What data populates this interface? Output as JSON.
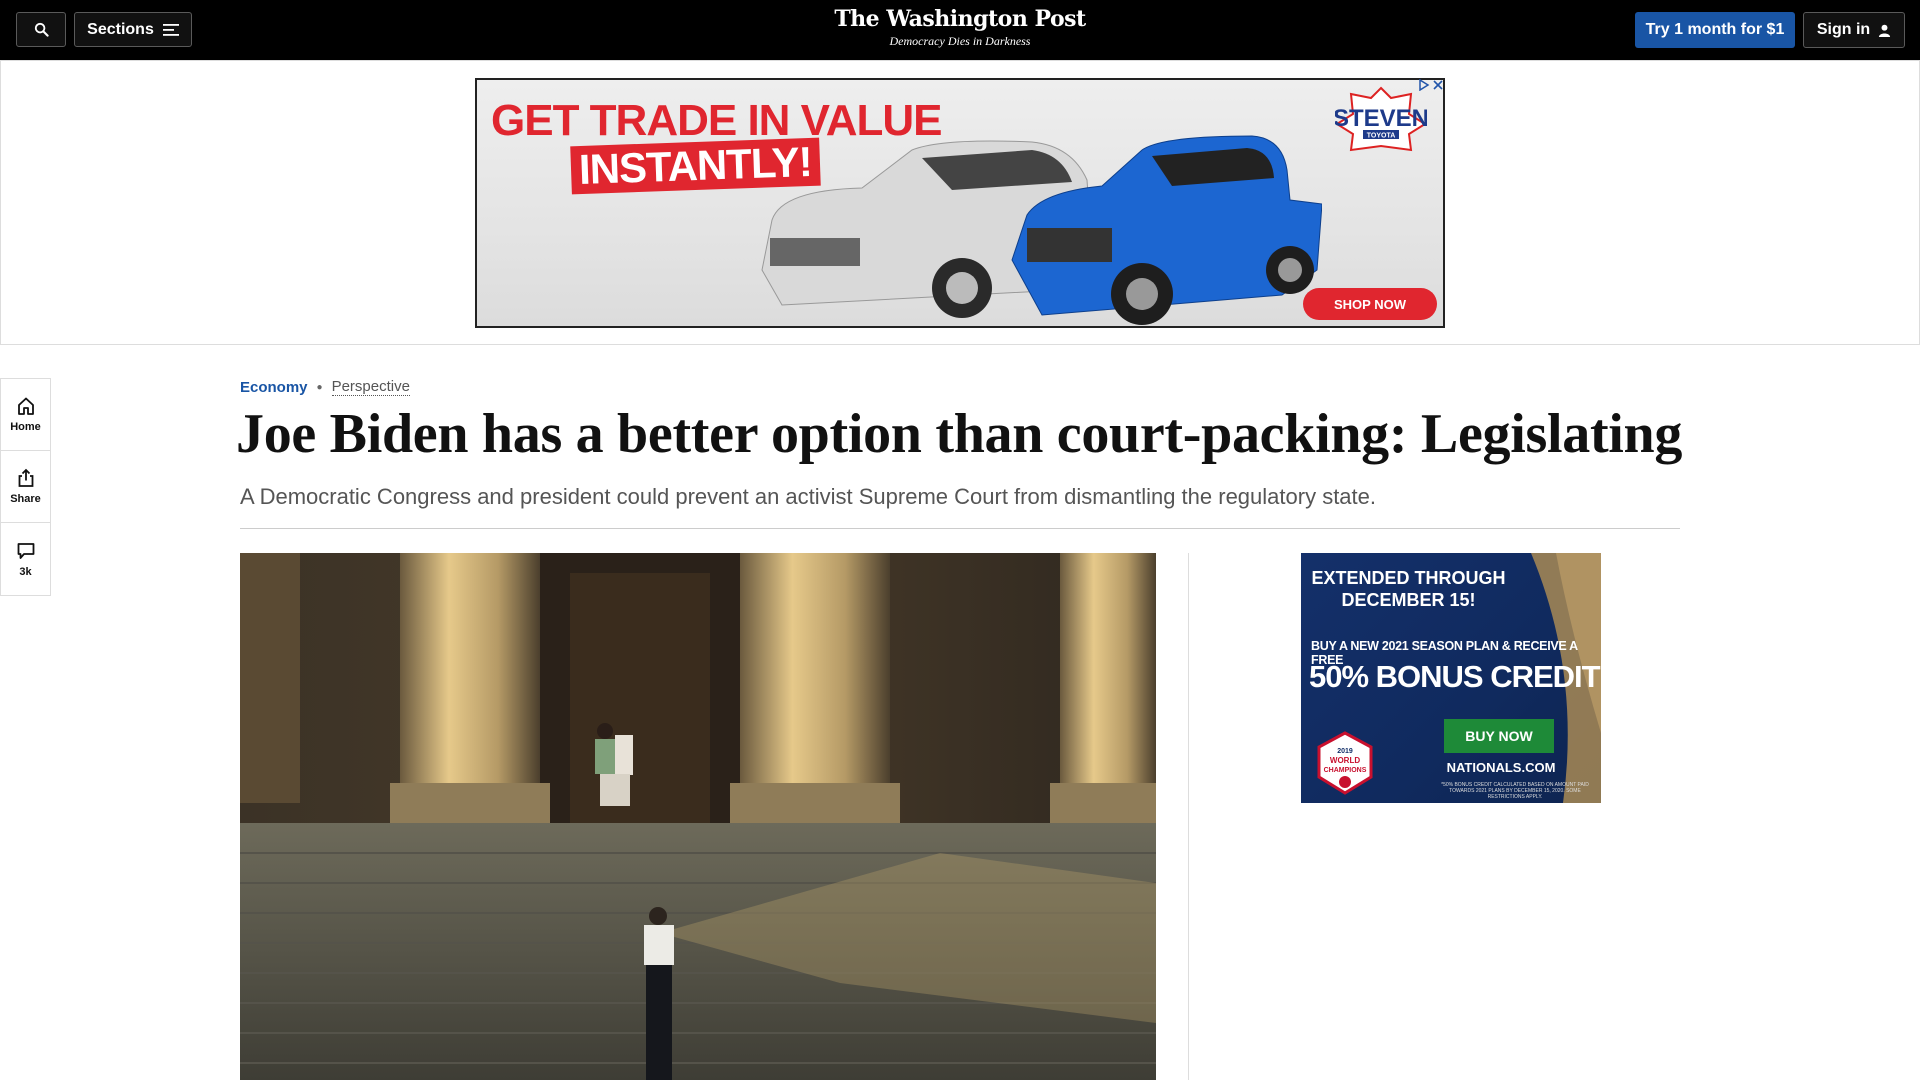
{
  "topbar": {
    "sections_label": "Sections",
    "logo": "The Washington Post",
    "tagline": "Democracy Dies in Darkness",
    "subscribe_label": "Try 1 month for $1",
    "signin_label": "Sign in"
  },
  "ad_banner": {
    "headline_line1": "GET TRADE IN VALUE",
    "headline_line2": "INSTANTLY!",
    "dealer_name": "STEVEN",
    "dealer_brand": "TOYOTA",
    "cta": "SHOP NOW"
  },
  "left_rail": {
    "items": [
      {
        "label": "Home",
        "icon": "home-icon"
      },
      {
        "label": "Share",
        "icon": "share-icon"
      },
      {
        "label": "3k",
        "icon": "comment-icon"
      }
    ]
  },
  "article": {
    "section": "Economy",
    "label": "Perspective",
    "headline": "Joe Biden has a better option than court-packing: Legislating",
    "dek": "A Democratic Congress and president could prevent an activist Supreme Court from dismantling the regulatory state."
  },
  "side_ad": {
    "line1": "EXTENDED THROUGH",
    "line2": "DECEMBER 15!",
    "offer_line": "BUY A NEW 2021 SEASON PLAN & RECEIVE A FREE",
    "offer_big": "50% BONUS CREDIT",
    "cta": "BUY NOW",
    "site": "NATIONALS.COM",
    "fine_print": "*50% BONUS CREDIT CALCULATED BASED ON AMOUNT PAID TOWARDS 2021 PLANS BY DECEMBER 15, 2020. SOME RESTRICTIONS APPLY.",
    "badge_line1": "2019",
    "badge_line2": "WORLD",
    "badge_line3": "CHAMPIONS"
  },
  "colors": {
    "topbar_bg": "#000000",
    "subscribe_bg": "#1955a5",
    "section_link": "#1955a5",
    "ad_red": "#e0262f",
    "nats_navy": "#14306a",
    "nats_green": "#1e8a38"
  }
}
